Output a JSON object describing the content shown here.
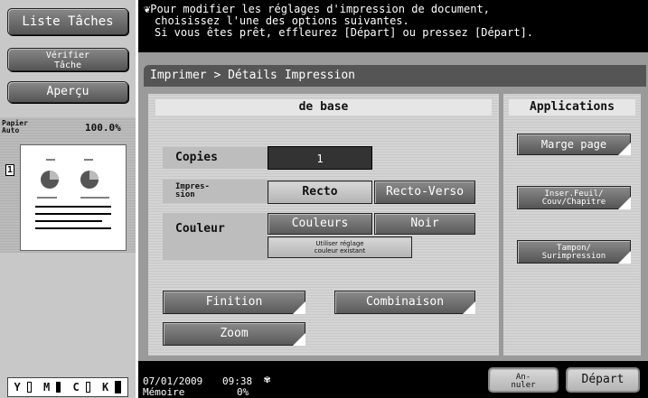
{
  "sidebar": {
    "job_list": "Liste Tâches",
    "check_job": "Vérifier Tâche",
    "preview": "Aperçu",
    "paper_label": "Papier Auto",
    "zoom": "100.0%",
    "page_badge": "1",
    "toner": [
      "Y",
      "M",
      "C",
      "K"
    ]
  },
  "message": {
    "line1": "Pour modifier les réglages d'impression de document,",
    "line2": "choisissez l'une des options suivantes.",
    "line3": "Si vous êtes prêt, effleurez [Départ] ou pressez [Départ]."
  },
  "breadcrumb": "Imprimer > Détails Impression",
  "tabs": {
    "basic": "de base",
    "applications": "Applications"
  },
  "copies": {
    "label": "Copies",
    "value": "1"
  },
  "print_side": {
    "label": "Impres-\nsion",
    "recto": "Recto",
    "recto_verso": "Recto-Verso"
  },
  "color": {
    "label": "Couleur",
    "colors": "Couleurs",
    "black": "Noir",
    "existing": "Utiliser réglage\ncouleur existant"
  },
  "finishing": "Finition",
  "combination": "Combinaison",
  "zoom_btn": "Zoom",
  "applications": {
    "margin": "Marge page",
    "insert": "Inser.Feuil/\nCouv/Chapitre",
    "stamp": "Tampon/\nSurimpression"
  },
  "footer": {
    "date": "07/01/2009",
    "time": "09:38",
    "memory_label": "Mémoire",
    "memory_value": "0%",
    "cancel": "An-\nnuler",
    "start": "Départ"
  }
}
